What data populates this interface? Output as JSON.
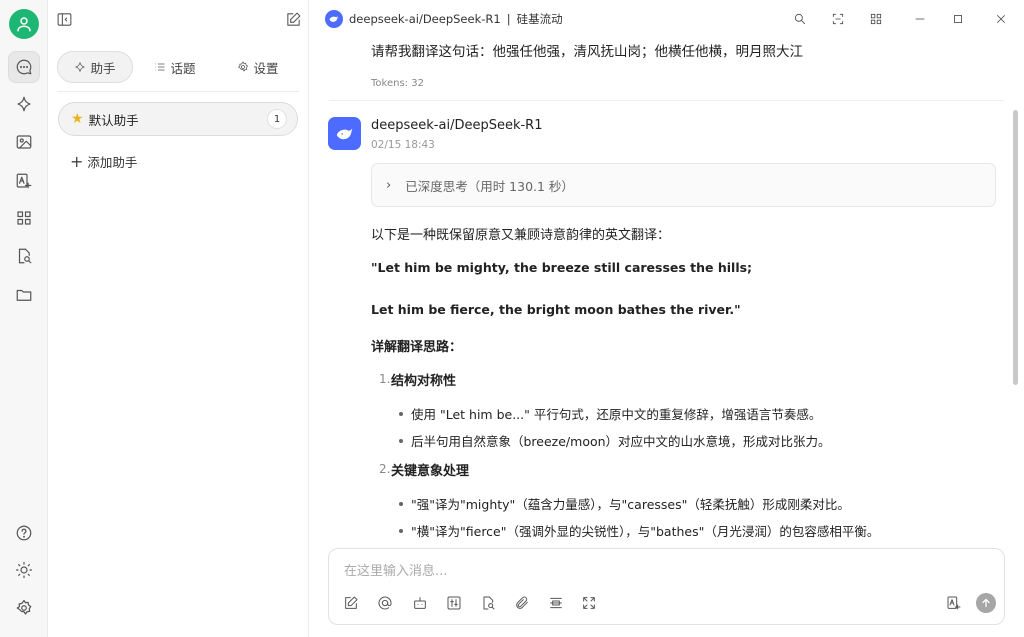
{
  "window": {
    "title_model": "deepseek-ai/DeepSeek-R1",
    "title_provider": "硅基流动",
    "title_separator": "|"
  },
  "colors": {
    "accent": "#1eb673",
    "deepseek_blue": "#4d6bfe",
    "star": "#e9b31b"
  },
  "rail": {
    "icons": [
      "user-avatar",
      "chat-icon",
      "sparkle-icon",
      "image-icon",
      "translate-icon",
      "apps-icon",
      "document-search-icon",
      "folder-icon",
      "help-icon",
      "sun-icon",
      "settings-icon"
    ]
  },
  "sidebar": {
    "tabs": [
      {
        "label": "助手",
        "icon": "sparkle-icon"
      },
      {
        "label": "话题",
        "icon": "list-icon"
      },
      {
        "label": "设置",
        "icon": "gear-icon"
      }
    ],
    "assistant": {
      "name": "默认助手",
      "count": "1"
    },
    "add_label": "添加助手"
  },
  "chat": {
    "user_message": "请帮我翻译这句话：他强任他强，清风抚山岗；他横任他横，明月照大江",
    "tokens": "Tokens: 32",
    "bot_name": "deepseek-ai/DeepSeek-R1",
    "bot_time": "02/15 18:43",
    "think_summary": "已深度思考（用时 130.1 秒）",
    "intro": "以下是一种既保留原意又兼顾诗意韵律的英文翻译：",
    "translation_line1": "\"Let him be mighty, the breeze still caresses the hills;",
    "translation_line2": "Let him be fierce, the bright moon bathes the river.\"",
    "explain_heading": "详解翻译思路：",
    "sections": [
      {
        "num": "1.",
        "title": "结构对称性",
        "bullets": [
          "使用 \"Let him be...\" 平行句式，还原中文的重复修辞，增强语言节奏感。",
          "后半句用自然意象（breeze/moon）对应中文的山水意境，形成对比张力。"
        ]
      },
      {
        "num": "2.",
        "title": "关键意象处理",
        "bullets": [
          "\"强\"译为\"mighty\"（蕴含力量感），与\"caresses\"（轻柔抚触）形成刚柔对比。",
          "\"横\"译为\"fierce\"（强调外显的尖锐性），与\"bathes\"（月光浸润）的包容感相平衡。"
        ]
      }
    ]
  },
  "composer": {
    "placeholder": "在这里输入消息..."
  }
}
